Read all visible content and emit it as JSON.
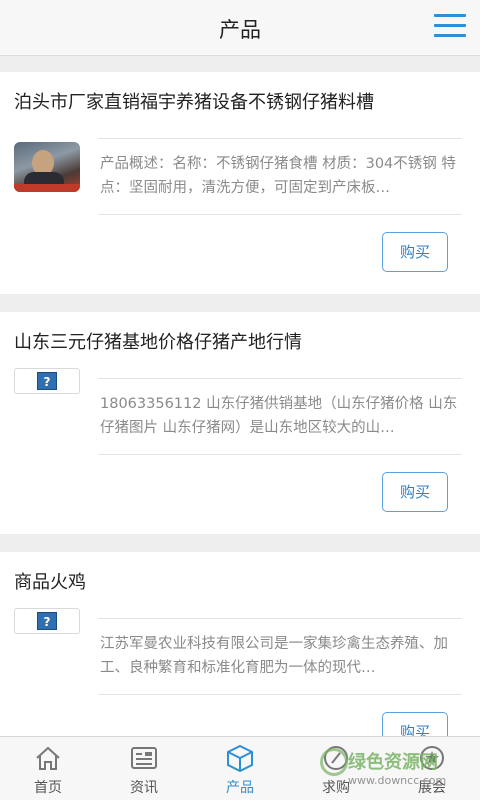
{
  "header": {
    "title": "产品"
  },
  "products": [
    {
      "title": "泊头市厂家直销福宇养猪设备不锈钢仔猪料槽",
      "desc": "产品概述：名称：不锈钢仔猪食槽 材质：304不锈钢 特点：坚固耐用，清洗方便，可固定到产床板…",
      "buy_label": "购买",
      "thumb": "photo"
    },
    {
      "title": "山东三元仔猪基地价格仔猪产地行情",
      "desc": "18063356112 山东仔猪供销基地（山东仔猪价格 山东仔猪图片 山东仔猪网）是山东地区较大的山…",
      "buy_label": "购买",
      "thumb": "placeholder"
    },
    {
      "title": "商品火鸡",
      "desc": "江苏军曼农业科技有限公司是一家集珍禽生态养殖、加工、良种繁育和标准化育肥为一体的现代…",
      "buy_label": "购买",
      "thumb": "placeholder"
    }
  ],
  "tabs": [
    {
      "label": "首页",
      "icon": "home-icon"
    },
    {
      "label": "资讯",
      "icon": "news-icon"
    },
    {
      "label": "产品",
      "icon": "cube-icon",
      "active": true
    },
    {
      "label": "求购",
      "icon": "purchase-icon"
    },
    {
      "label": "展会",
      "icon": "exhibition-icon"
    }
  ],
  "watermark": {
    "line1": "绿色资源网",
    "line2": "www.downcc.com"
  },
  "colors": {
    "accent": "#2e8fd6",
    "background": "#eeeeee"
  }
}
